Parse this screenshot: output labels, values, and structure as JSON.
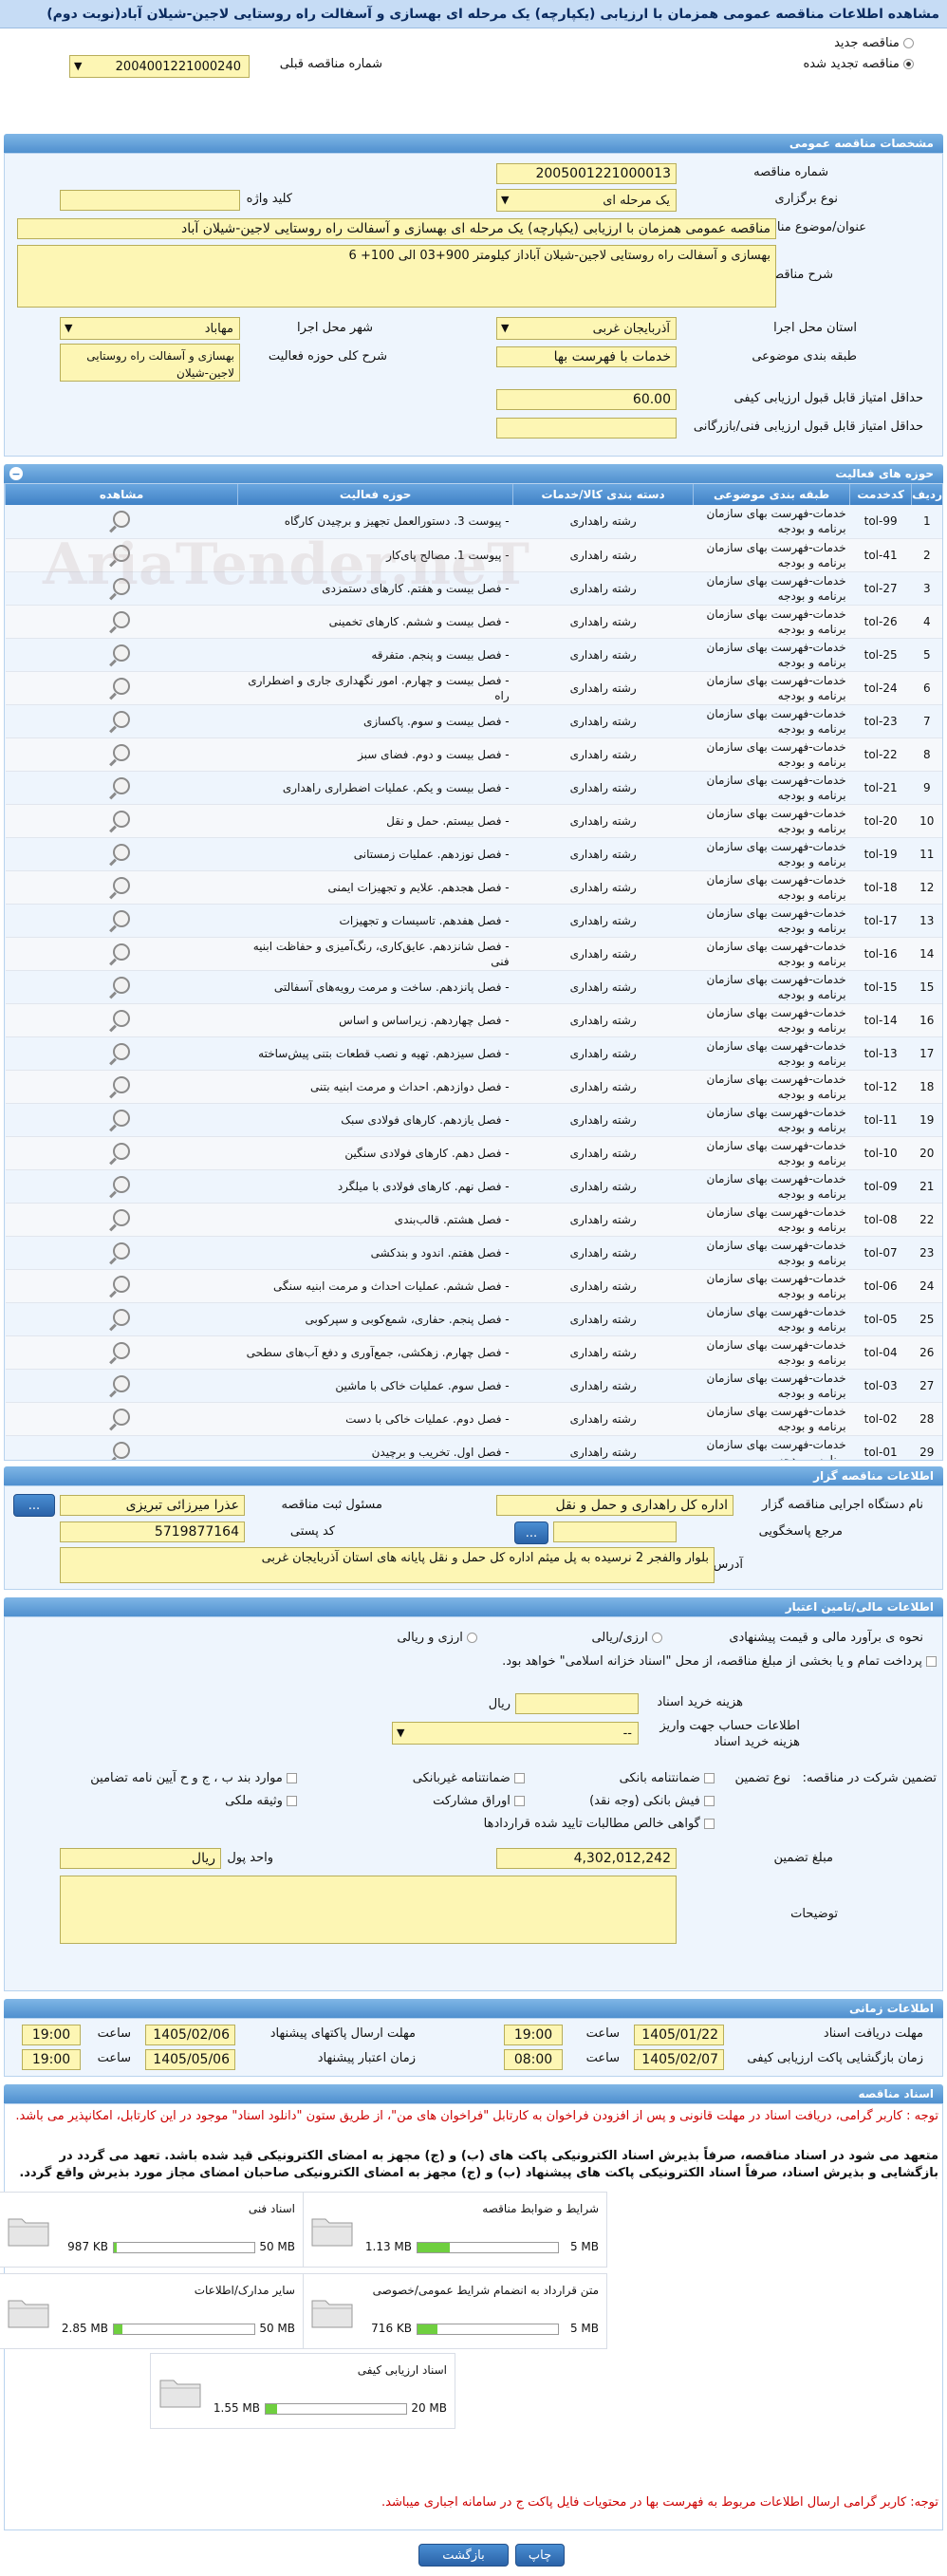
{
  "title": "مشاهده اطلاعات مناقصه عمومی همزمان با ارزیابی (یکپارچه) یک مرحله ای بهسازی و آسفالت راه روستایی لاجین-شیلان آباد(نوبت دوم)",
  "top": {
    "radio_new": "مناقصه جدید",
    "radio_renew": "مناقصه تجدید شده",
    "prev_number_label": "شماره مناقصه قبلی",
    "prev_number": "2004001221000240"
  },
  "general": {
    "header": "مشخصات مناقصه عمومی",
    "number_label": "شماره مناقصه",
    "number": "2005001221000013",
    "type_label": "نوع برگزاری",
    "type_value": "یک مرحله ای",
    "keyword_label": "کلید واژه",
    "keyword": "",
    "subject_label": "عنوان/موضوع مناقصه",
    "subject": "مناقصه عمومی همزمان با ارزیابی (یکپارچه) یک مرحله ای بهسازی و آسفالت راه روستایی لاجین-شیلان آباد",
    "desc_label": "شرح مناقصه",
    "desc": "بهسازی و آسفالت راه روستایی لاجین-شیلان آباداز کیلومتر 900+03 الی 100+ 6",
    "province_label": "استان محل اجرا",
    "province": "آذربایجان غربی",
    "city_label": "شهر محل اجرا",
    "city": "مهاباد",
    "category_label": "طبقه بندی موضوعی",
    "category": "خدمات با فهرست بها",
    "scope_label": "شرح کلی حوزه فعالیت",
    "scope": "بهسازی و آسفالت راه روستایی لاجین-شیلان",
    "min_quality_label": "حداقل امتیاز قابل قبول ارزیابی کیفی",
    "min_quality": "60.00",
    "min_tech_label": "حداقل امتیاز قابل قبول ارزیابی فنی/بازرگانی",
    "min_tech": ""
  },
  "activities": {
    "header": "حوزه های فعالیت",
    "columns": [
      "ردیف",
      "کدخدمت",
      "طبقه بندی موضوعی",
      "دسته بندی کالا/خدمات",
      "حوزه فعالیت",
      "مشاهده"
    ],
    "rows": [
      [
        "1",
        "tol-99",
        "خدمات-فهرست بهای سازمان برنامه و بودجه",
        "رشته راهداری",
        "- پیوست 3. دستورالعمل تجهیز و برچیدن کارگاه"
      ],
      [
        "2",
        "tol-41",
        "خدمات-فهرست بهای سازمان برنامه و بودجه",
        "رشته راهداری",
        "- پیوست 1. مصالح پای‌کار"
      ],
      [
        "3",
        "tol-27",
        "خدمات-فهرست بهای سازمان برنامه و بودجه",
        "رشته راهداری",
        "- فصل بیست و هفتم. کارهای دستمزدی"
      ],
      [
        "4",
        "tol-26",
        "خدمات-فهرست بهای سازمان برنامه و بودجه",
        "رشته راهداری",
        "- فصل بیست و ششم. کارهای تخمینی"
      ],
      [
        "5",
        "tol-25",
        "خدمات-فهرست بهای سازمان برنامه و بودجه",
        "رشته راهداری",
        "- فصل بیست و پنجم. متفرقه"
      ],
      [
        "6",
        "tol-24",
        "خدمات-فهرست بهای سازمان برنامه و بودجه",
        "رشته راهداری",
        "- فصل بیست و چهارم. امور نگهداری جاری و اضطراری راه"
      ],
      [
        "7",
        "tol-23",
        "خدمات-فهرست بهای سازمان برنامه و بودجه",
        "رشته راهداری",
        "- فصل بیست و سوم. پاکسازی"
      ],
      [
        "8",
        "tol-22",
        "خدمات-فهرست بهای سازمان برنامه و بودجه",
        "رشته راهداری",
        "- فصل بیست و دوم. فضای سبز"
      ],
      [
        "9",
        "tol-21",
        "خدمات-فهرست بهای سازمان برنامه و بودجه",
        "رشته راهداری",
        "- فصل بیست و یکم. عملیات اضطراری راهداری"
      ],
      [
        "10",
        "tol-20",
        "خدمات-فهرست بهای سازمان برنامه و بودجه",
        "رشته راهداری",
        "- فصل بیستم. حمل و نقل"
      ],
      [
        "11",
        "tol-19",
        "خدمات-فهرست بهای سازمان برنامه و بودجه",
        "رشته راهداری",
        "- فصل نوزدهم. عملیات زمستانی"
      ],
      [
        "12",
        "tol-18",
        "خدمات-فهرست بهای سازمان برنامه و بودجه",
        "رشته راهداری",
        "- فصل هجدهم. علایم و تجهیزات ایمنی"
      ],
      [
        "13",
        "tol-17",
        "خدمات-فهرست بهای سازمان برنامه و بودجه",
        "رشته راهداری",
        "- فصل هفدهم. تاسیسات و تجهیزات"
      ],
      [
        "14",
        "tol-16",
        "خدمات-فهرست بهای سازمان برنامه و بودجه",
        "رشته راهداری",
        "- فصل شانزدهم. عایق‌کاری، رنگ‌آمیزی و حفاظت ابنیه فنی"
      ],
      [
        "15",
        "tol-15",
        "خدمات-فهرست بهای سازمان برنامه و بودجه",
        "رشته راهداری",
        "- فصل پانزدهم. ساخت و مرمت رویه‌های آسفالتی"
      ],
      [
        "16",
        "tol-14",
        "خدمات-فهرست بهای سازمان برنامه و بودجه",
        "رشته راهداری",
        "- فصل چهاردهم. زیراساس و اساس"
      ],
      [
        "17",
        "tol-13",
        "خدمات-فهرست بهای سازمان برنامه و بودجه",
        "رشته راهداری",
        "- فصل سیزدهم. تهیه و نصب قطعات بتنی پیش‌ساخته"
      ],
      [
        "18",
        "tol-12",
        "خدمات-فهرست بهای سازمان برنامه و بودجه",
        "رشته راهداری",
        "- فصل دوازدهم. احداث و مرمت ابنیه بتنی"
      ],
      [
        "19",
        "tol-11",
        "خدمات-فهرست بهای سازمان برنامه و بودجه",
        "رشته راهداری",
        "- فصل یازدهم. کارهای فولادی سبک"
      ],
      [
        "20",
        "tol-10",
        "خدمات-فهرست بهای سازمان برنامه و بودجه",
        "رشته راهداری",
        "- فصل دهم. کارهای فولادی سنگین"
      ],
      [
        "21",
        "tol-09",
        "خدمات-فهرست بهای سازمان برنامه و بودجه",
        "رشته راهداری",
        "- فصل نهم. کارهای فولادی با میلگرد"
      ],
      [
        "22",
        "tol-08",
        "خدمات-فهرست بهای سازمان برنامه و بودجه",
        "رشته راهداری",
        "- فصل هشتم. قالب‌بندی"
      ],
      [
        "23",
        "tol-07",
        "خدمات-فهرست بهای سازمان برنامه و بودجه",
        "رشته راهداری",
        "- فصل هفتم. اندود و بندکشی"
      ],
      [
        "24",
        "tol-06",
        "خدمات-فهرست بهای سازمان برنامه و بودجه",
        "رشته راهداری",
        "- فصل ششم. عملیات احداث و مرمت ابنیه سنگی"
      ],
      [
        "25",
        "tol-05",
        "خدمات-فهرست بهای سازمان برنامه و بودجه",
        "رشته راهداری",
        "- فصل پنجم. حفاری، شمع‌کوبی و سپرکوبی"
      ],
      [
        "26",
        "tol-04",
        "خدمات-فهرست بهای سازمان برنامه و بودجه",
        "رشته راهداری",
        "- فصل چهارم. زهکشی، جمع‌آوری و دفع آب‌های سطحی"
      ],
      [
        "27",
        "tol-03",
        "خدمات-فهرست بهای سازمان برنامه و بودجه",
        "رشته راهداری",
        "- فصل سوم. عملیات خاکی با ماشین"
      ],
      [
        "28",
        "tol-02",
        "خدمات-فهرست بهای سازمان برنامه و بودجه",
        "رشته راهداری",
        "- فصل دوم. عملیات خاکی با دست"
      ],
      [
        "29",
        "tol-01",
        "خدمات-فهرست بهای سازمان برنامه و بودجه",
        "رشته راهداری",
        "- فصل اول. تخریب و برچیدن"
      ]
    ]
  },
  "organizer": {
    "header": "اطلاعات مناقصه گزار",
    "org_label": "نام دستگاه اجرایی مناقصه گزار",
    "org": "اداره کل راهداری و حمل و نقل",
    "responsible_label": "مسئول ثبت مناقصه",
    "responsible": "عذرا میرزائی تبریزی",
    "ref_label": "مرجع پاسخگویی",
    "ref": "",
    "postal_label": "کد پستی",
    "postal": "5719877164",
    "address_label": "آدرس",
    "address": "بلوار والفجر 2 نرسیده به پل میثم اداره کل حمل و نقل پایانه های استان آذربایجان غربی",
    "more_btn": "..."
  },
  "finance": {
    "header": "اطلاعات مالی/تامین اعتبار",
    "estimate_label": "نحوه ی برآورد مالی و قیمت پیشنهادی",
    "opt_rial_currency": "ارزی/ریالی",
    "opt_currency_and_rial": "ارزی و ریالی",
    "payment_note": "پرداخت تمام و یا بخشی از مبلغ مناقصه، از محل \"اسناد خزانه اسلامی\" خواهد بود.",
    "doc_fee_label": "هزینه خرید اسناد",
    "doc_fee_unit": "ریال",
    "account_label": "اطلاعات حساب جهت واریز هزینه خرید اسناد",
    "account_value": "--",
    "guarantee_label": "تضمین شرکت در مناقصه:",
    "guarantee_type_label": "نوع تضمین",
    "g1": "ضمانتنامه بانکی",
    "g2": "ضمانتنامه غیربانکی",
    "g3": "موارد بند ب ، ج و ح آیین نامه تضامین",
    "g4": "فیش بانکی (وجه نقد)",
    "g5": "اوراق مشارکت",
    "g6": "وثیقه ملکی",
    "g7": "گواهی خالص مطالبات تایید شده قراردادها",
    "amount_label": "مبلغ تضمین",
    "amount": "4,302,012,242",
    "currency_label": "واحد پول",
    "currency": "ریال",
    "notes_label": "توضیحات",
    "notes": ""
  },
  "timing": {
    "header": "اطلاعات زمانی",
    "receive_deadline_label": "مهلت دریافت اسناد",
    "receive_deadline_date": "1405/01/22",
    "receive_deadline_time": "19:00",
    "send_deadline_label": "مهلت ارسال پاکتهای پیشنهاد",
    "send_deadline_date": "1405/02/06",
    "send_deadline_time": "19:00",
    "opening_label": "زمان بازگشایی پاکت ارزیابی کیفی",
    "opening_date": "1405/02/07",
    "opening_time": "08:00",
    "validity_label": "زمان اعتبار پیشنهاد",
    "validity_date": "1405/05/06",
    "validity_time": "19:00",
    "time_label": "ساعت"
  },
  "documents": {
    "header": "اسناد مناقصه",
    "note1": "توجه : کاربر گرامی، دریافت اسناد در مهلت قانونی و پس از افزودن فراخوان به کارتابل \"فراخوان های من\"، از طریق ستون \"دانلود اسناد\" موجود در این کارتابل، امکانپذیر می باشد.",
    "note2": "متعهد می شود در اسناد مناقصه، صرفاً بذیرش اسناد الکترونیکی پاکت های (ب) و (ج) مجهز به امضای الکترونیکی قید شده باشد. تعهد می گردد در بازگشایی و بذیرش اسناد، صرفاً اسناد الکترونیکی پاکت های پیشنهاد (ب) و (ج) مجهز به امضای الکترونیکی صاحبان امضای مجاز مورد بذیرش واقع گردد.",
    "files": [
      {
        "name": "شرایط و ضوابط مناقصه",
        "size": "1.13 MB",
        "max": "5 MB",
        "fill": 0.23
      },
      {
        "name": "اسناد فنی",
        "size": "987 KB",
        "max": "50 MB",
        "fill": 0.02
      },
      {
        "name": "متن قرارداد به انضمام شرایط عمومی/خصوصی",
        "size": "716 KB",
        "max": "5 MB",
        "fill": 0.14
      },
      {
        "name": "سایر مدارک/اطلاعات",
        "size": "2.85 MB",
        "max": "50 MB",
        "fill": 0.06
      },
      {
        "name": "اسناد ارزیابی کیفی",
        "size": "1.55 MB",
        "max": "20 MB",
        "fill": 0.08
      }
    ],
    "note3": "توجه: کاربر گرامی ارسال اطلاعات مربوط به فهرست بها در محتویات فایل پاکت ج در سامانه اجباری میباشد."
  },
  "buttons": {
    "print": "چاپ",
    "back": "بازگشت"
  },
  "watermark": "AriaTender.neT"
}
